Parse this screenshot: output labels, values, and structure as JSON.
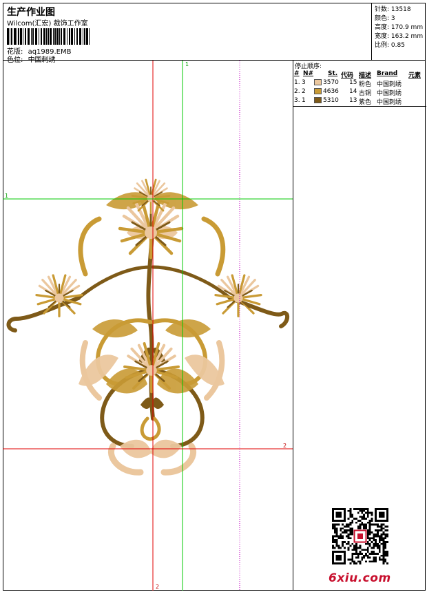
{
  "header": {
    "title": "生产作业图",
    "company": "Wilcom(汇宏) 裁饰工作室",
    "file_label": "花版:",
    "file_name": "aq1989.EMB",
    "color_label": "色位:",
    "color_name": "中国刺绣"
  },
  "stats": [
    {
      "label": "针数:",
      "value": "13518"
    },
    {
      "label": "颜色:",
      "value": "3"
    },
    {
      "label": "高度:",
      "value": "170.9 mm"
    },
    {
      "label": "宽度:",
      "value": "163.2 mm"
    },
    {
      "label": "比例:",
      "value": "0.85"
    }
  ],
  "stop_order": {
    "title": "停止顺序:",
    "headers": [
      "#",
      "N#",
      "St.",
      "代码",
      "描述",
      "Brand",
      "元素"
    ],
    "rows": [
      {
        "index": "1.",
        "num": "3",
        "swatch": "#EBC79E",
        "code": "3570",
        "stitch": "15",
        "desc": "粉色",
        "brand": "中国刺绣"
      },
      {
        "index": "2.",
        "num": "2",
        "swatch": "#C99B35",
        "code": "4636",
        "stitch": "14",
        "desc": "古铜",
        "brand": "中国刺绣"
      },
      {
        "index": "3.",
        "num": "1",
        "swatch": "#7E5A18",
        "code": "5310",
        "stitch": "13",
        "desc": "紫色",
        "brand": "中国刺绣"
      }
    ]
  },
  "guides": {
    "v_green_label": "1",
    "h_green_label": "1",
    "h_red_label": "2",
    "v_red_label": "2"
  },
  "watermark": "6xiu.com",
  "colors": {
    "guide_red": "#E00000",
    "guide_green": "#00C800",
    "guide_magenta": "#C000C0",
    "thread_light": "#EBC79E",
    "thread_mid": "#C99B35",
    "thread_dark": "#7E5A18",
    "watermark": "#C8102E"
  }
}
